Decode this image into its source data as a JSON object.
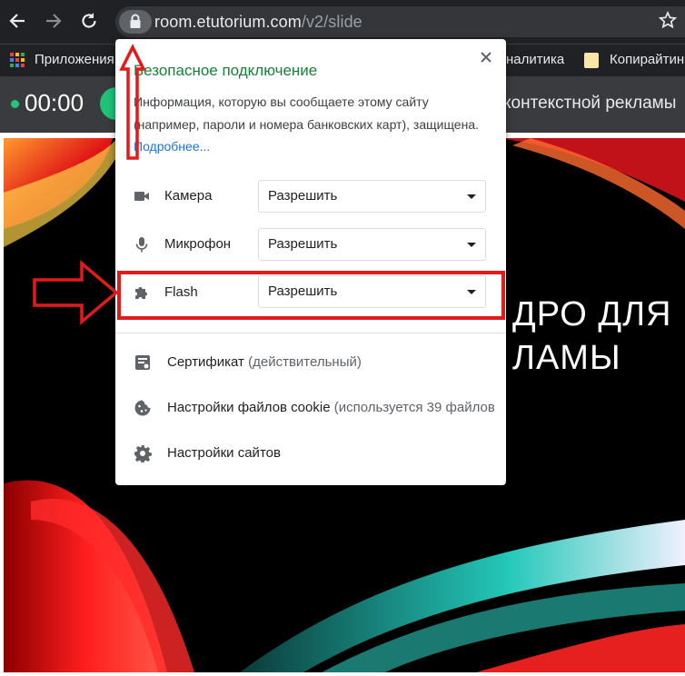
{
  "browser": {
    "url_domain": "room.etutorium.com",
    "url_path": "/v2/slide",
    "back_icon": "arrow-left",
    "forward_icon": "arrow-right",
    "reload_icon": "reload",
    "bookmark_star_icon": "star"
  },
  "bookmarks": {
    "apps_label": "Приложения",
    "item_analytics": "налитика",
    "item_copywriting": "Копирайтин"
  },
  "app_header": {
    "timer": "00:00",
    "title_fragment": "контекстной рекламы"
  },
  "slide": {
    "title_line1": "ДРО ДЛЯ",
    "title_line2": "ЛАМЫ"
  },
  "popup": {
    "title": "Безопасное подключение",
    "description": "Информация, которую вы сообщаете этому сайту (например, пароли и номера банковских карт), защищена.",
    "learn_more": "Подробнее...",
    "close_icon": "close",
    "permissions": [
      {
        "icon": "camera-icon",
        "label": "Камера",
        "value": "Разрешить"
      },
      {
        "icon": "microphone-icon",
        "label": "Микрофон",
        "value": "Разрешить"
      },
      {
        "icon": "puzzle-icon",
        "label": "Flash",
        "value": "Разрешить"
      }
    ],
    "links": [
      {
        "icon": "certificate-icon",
        "label": "Сертификат",
        "note": "(действительный)"
      },
      {
        "icon": "cookie-icon",
        "label": "Настройки файлов cookie",
        "note": "(используется 39 файлов"
      },
      {
        "icon": "gear-icon",
        "label": "Настройки сайтов",
        "note": ""
      }
    ]
  },
  "colors": {
    "toolbar_bg": "#202124",
    "popup_title": "#188038",
    "link_blue": "#1a73e8",
    "annotation_red": "#e31a1a",
    "timer_dot": "#20c77a"
  }
}
